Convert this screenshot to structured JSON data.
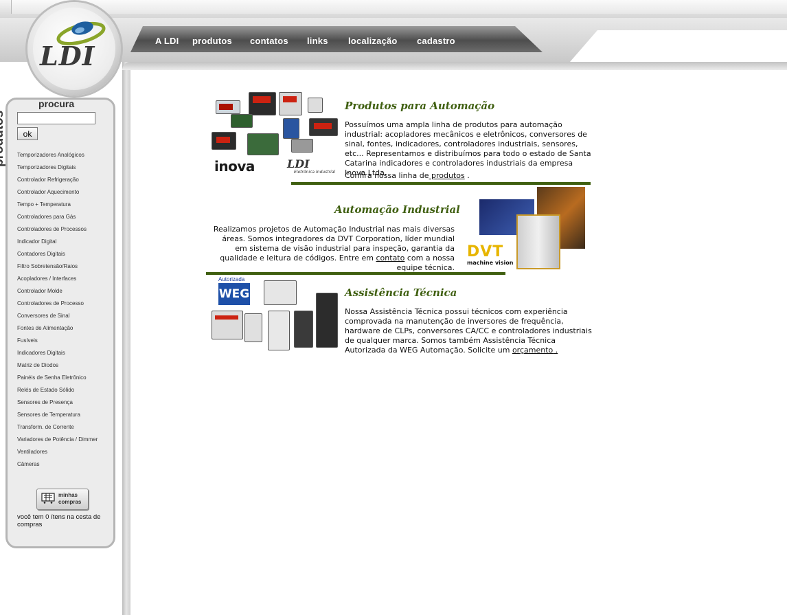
{
  "brand": {
    "logo_text": "LDI"
  },
  "nav": {
    "items": [
      {
        "label": "A LDI"
      },
      {
        "label": "produtos"
      },
      {
        "label": "contatos"
      },
      {
        "label": "links"
      },
      {
        "label": "localização"
      },
      {
        "label": "cadastro"
      }
    ]
  },
  "sidebar": {
    "vertical_label": "produtos",
    "search": {
      "title": "procura",
      "value": "",
      "button_label": "ok"
    },
    "categories": [
      "Temporizadores Analógicos",
      "Temporizadores Digitais",
      "Controlador Refrigeração",
      "Controlador Aquecimento",
      "Tempo + Temperatura",
      "Controladores para Gás",
      "Controladores de Processos",
      "Indicador Digital",
      "Contadores Digitais",
      "Filtro Sobretensão/Raios",
      "Acopladores / Interfaces",
      "Controlador Molde",
      "Controladores de Processo",
      "Conversores de Sinal",
      "Fontes de Alimentação",
      "Fusíveis",
      "Indicadores Digitais",
      "Matriz de Diodos",
      "Painéis de Senha Eletrônico",
      "Relés de Estado Sólido",
      "Sensores de Presença",
      "Sensores de Temperatura",
      "Transform. de Corrente",
      "Variadores de Potência / Dimmer",
      "Ventiladores",
      "Câmeras"
    ],
    "cart_button": {
      "line1": "minhas",
      "line2": "compras"
    },
    "cart_status": "você tem 0 ítens na cesta de compras"
  },
  "sections": {
    "produtos": {
      "title": "Produtos para Automação",
      "text": "Possuímos uma ampla linha de produtos para automação industrial: acopladores mecânicos e eletrônicos, conversores de sinal, fontes, indicadores, controladores industriais, sensores, etc... Representamos e distribuímos para todo o estado de Santa Catarina indicadores e controladores industriais da empresa Inova Ltda.",
      "link_prefix": "Confira nossa linha de",
      "link_text": " produtos",
      "link_suffix": " .",
      "image_brands": {
        "left": "inova",
        "right": "LDI",
        "right_sub": "Eletrônica Industrial"
      }
    },
    "automacao": {
      "title": "Automação Industrial",
      "text_before": "Realizamos projetos de Automação Industrial nas mais diversas áreas. Somos integradores da DVT Corporation, líder mundial em sistema de visão industrial para inspeção, garantia da qualidade e leitura de códigos. Entre em ",
      "link_text": "contato",
      "text_after": " com a nossa equipe técnica.",
      "image_brand": "DVT",
      "image_sub": "machine vision"
    },
    "assistencia": {
      "title": "Assistência Técnica",
      "text_before": "Nossa Assistência Técnica possui técnicos com experiência comprovada na manutenção de inversores de frequência, hardware de CLPs, conversores CA/CC e controladores industriais de qualquer marca. Somos também Assistência Técnica Autorizada da WEG Automação. Solicite um ",
      "link_text": "orçamento",
      "link_suffix": " .",
      "image_brand_top": "Autorizada",
      "image_brand": "WEG"
    }
  },
  "colors": {
    "accent": "#3f5f10",
    "nav_bg": "#5a5a5a"
  }
}
